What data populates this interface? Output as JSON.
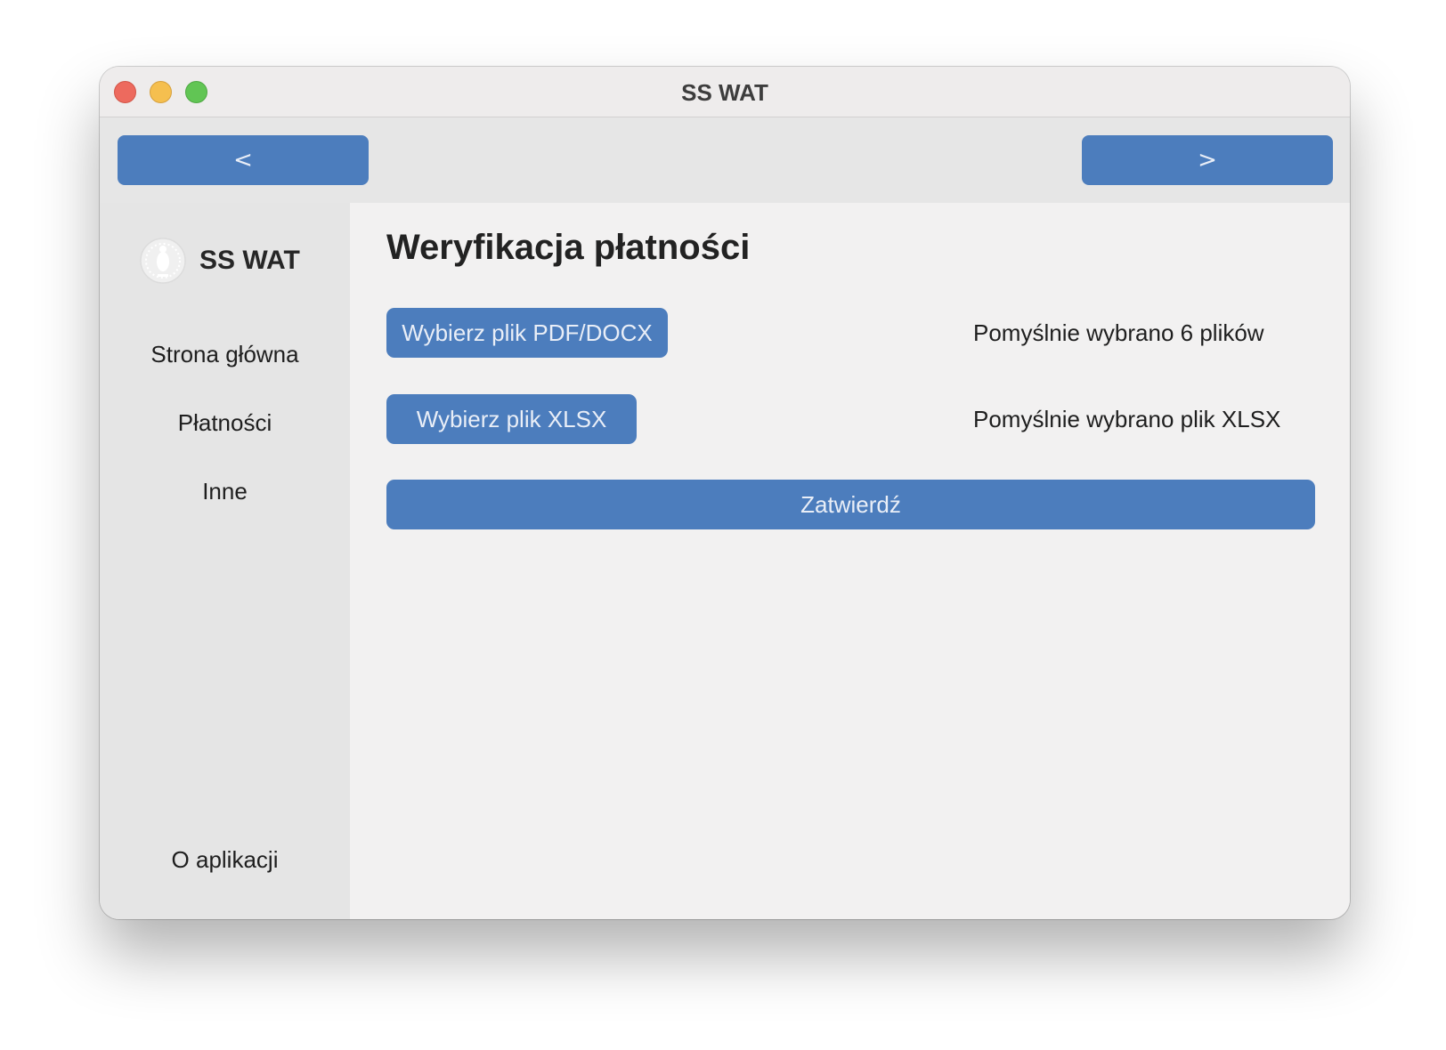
{
  "window": {
    "title": "SS WAT",
    "controls": [
      "close",
      "minimize",
      "maximize"
    ]
  },
  "navbar": {
    "back_label": "<",
    "forward_label": ">"
  },
  "sidebar": {
    "brand_name": "SS WAT",
    "logo_icon": "seal-logo-icon",
    "items": [
      {
        "label": "Strona główna"
      },
      {
        "label": "Płatności"
      },
      {
        "label": "Inne"
      }
    ],
    "footer_item": {
      "label": "O aplikacji"
    }
  },
  "main": {
    "title": "Weryfikacja płatności",
    "pdf_button_label": "Wybierz plik PDF/DOCX",
    "pdf_status": "Pomyślnie wybrano 6 plików",
    "xlsx_button_label": "Wybierz plik XLSX",
    "xlsx_status": "Pomyślnie wybrano plik XLSX",
    "submit_label": "Zatwierdź"
  },
  "colors": {
    "accent": "#4c7dbd",
    "sidebar_bg": "#e5e5e5",
    "content_bg": "#f2f1f1",
    "close": "#ed6a5e",
    "minimize": "#f5bf4f",
    "maximize": "#61c554"
  }
}
